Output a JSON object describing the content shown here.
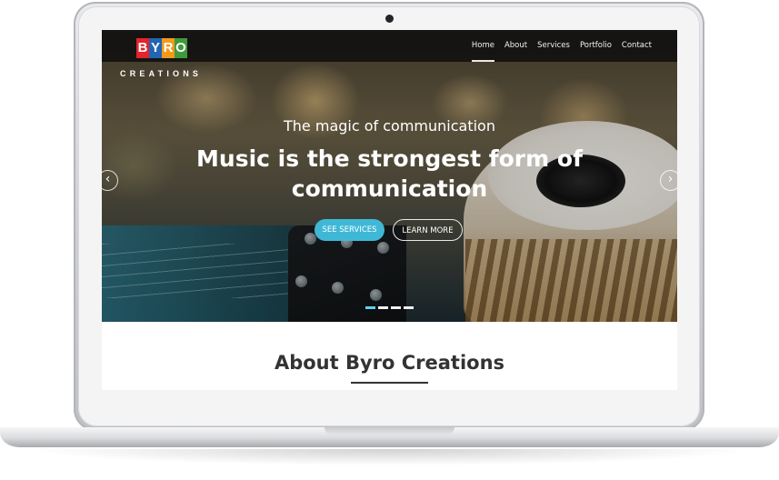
{
  "brand": {
    "logo_letters": [
      "B",
      "Y",
      "R",
      "O"
    ],
    "logo_colors": [
      "#e4232a",
      "#2165b5",
      "#f39a1b",
      "#3e9a3b"
    ],
    "tagline": "CREATIONS"
  },
  "nav": {
    "items": [
      {
        "label": "Home",
        "active": true
      },
      {
        "label": "About",
        "active": false
      },
      {
        "label": "Services",
        "active": false
      },
      {
        "label": "Portfolio",
        "active": false
      },
      {
        "label": "Contact",
        "active": false
      }
    ]
  },
  "hero": {
    "subtitle": "The magic of communication",
    "title": "Music is the strongest form of communication",
    "primary_button": "SEE SERVICES",
    "secondary_button": "LEARN MORE",
    "prev_icon": "chevron-left-icon",
    "next_icon": "chevron-right-icon",
    "slide_count": 4,
    "active_slide": 1
  },
  "about": {
    "title": "About Byro Creations"
  },
  "colors": {
    "accent": "#3fb8d6",
    "navbar": "#0e0e0e",
    "heading": "#333333"
  }
}
